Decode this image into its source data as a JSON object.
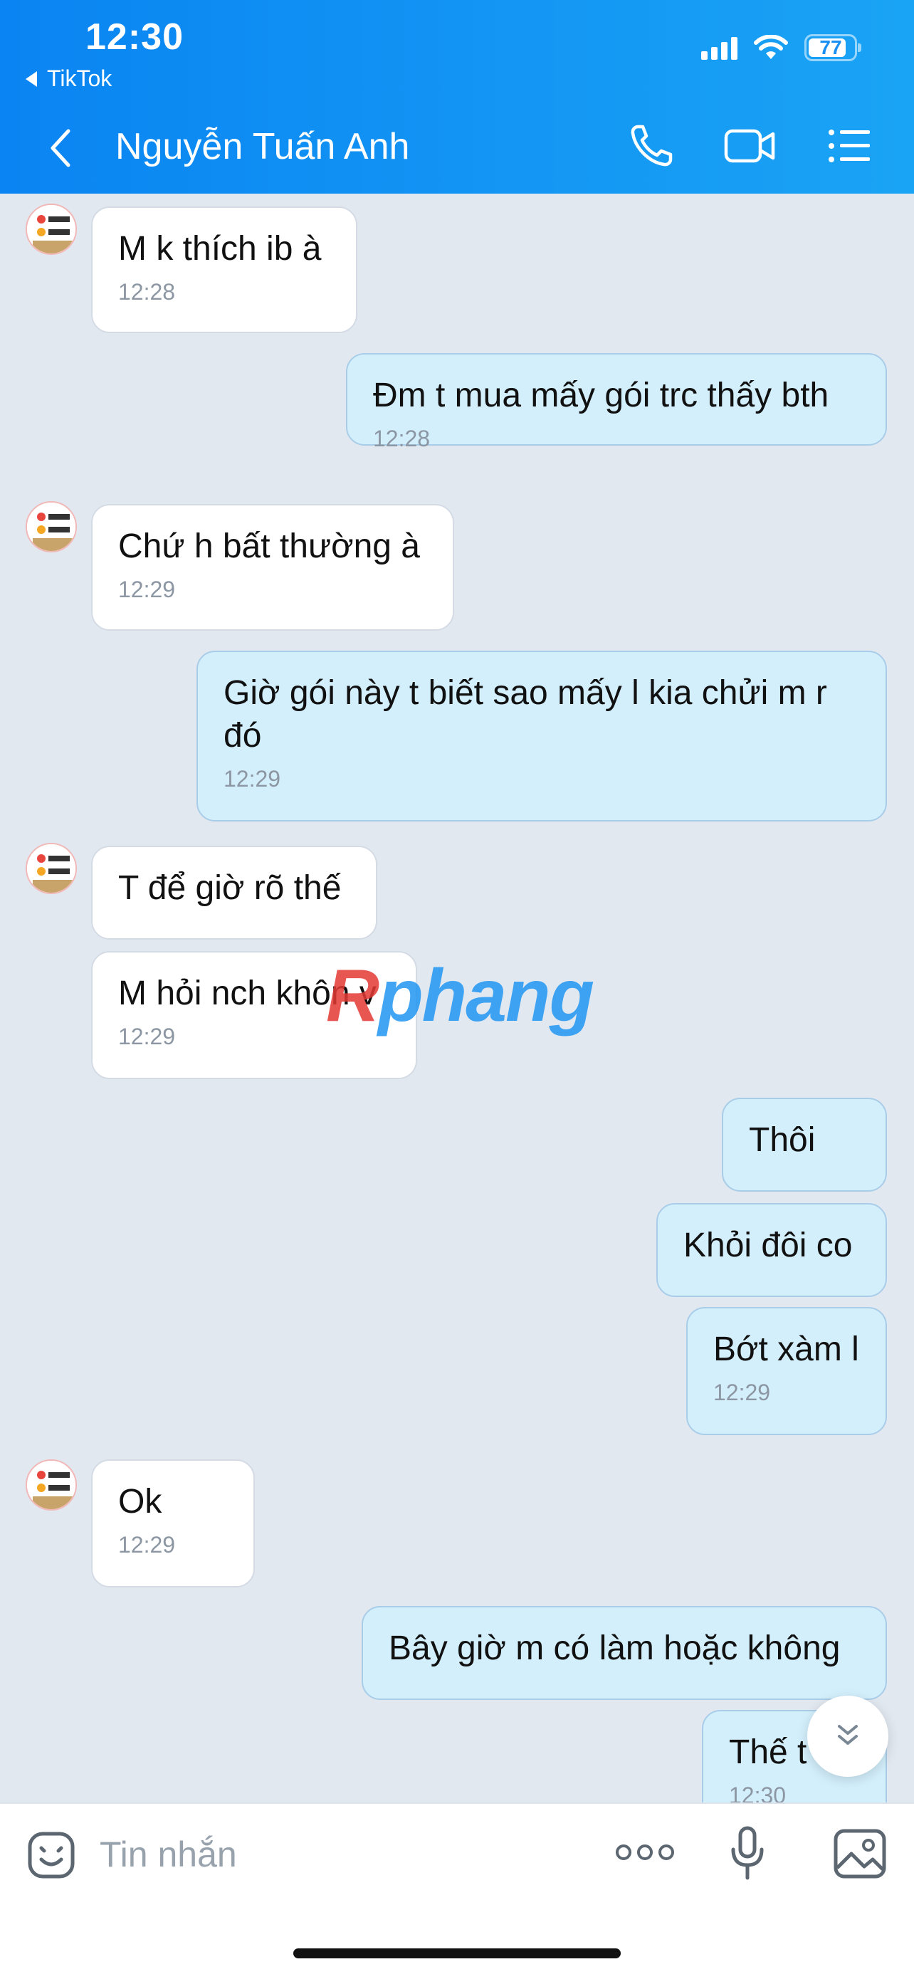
{
  "status_bar": {
    "time": "12:30",
    "back_app": "TikTok",
    "battery": "77"
  },
  "header": {
    "contact_name": "Nguyễn Tuấn Anh",
    "icons": [
      "back-chevron-icon",
      "phone-icon",
      "video-call-icon",
      "menu-list-icon"
    ]
  },
  "messages": [
    {
      "side": "in",
      "text": "M k thích ib à",
      "time": "12:28",
      "avatar": true
    },
    {
      "side": "out",
      "text": "Đm t mua mấy gói trc thấy bth",
      "time": "12:28"
    },
    {
      "side": "in",
      "text": "Chứ h bất thường à",
      "time": "12:29",
      "avatar": true
    },
    {
      "side": "out",
      "text": "Giờ gói này t biết sao mấy l kia chửi m r đó",
      "time": "12:29"
    },
    {
      "side": "in",
      "text": "T để giờ rõ thế",
      "time": "",
      "avatar": true
    },
    {
      "side": "in",
      "text": "M hỏi nch khôn v",
      "time": "12:29"
    },
    {
      "side": "out",
      "text": "Thôi",
      "time": ""
    },
    {
      "side": "out",
      "text": "Khỏi đôi co",
      "time": ""
    },
    {
      "side": "out",
      "text": "Bớt xàm l",
      "time": "12:29"
    },
    {
      "side": "in",
      "text": "Ok",
      "time": "12:29",
      "avatar": true
    },
    {
      "side": "out",
      "text": "Bây giờ m có làm hoặc không",
      "time": ""
    },
    {
      "side": "out",
      "text": "Thế t",
      "time": "12:30"
    }
  ],
  "watermark": {
    "r": "R",
    "rest": "phang"
  },
  "composer": {
    "placeholder": "Tin nhắn"
  },
  "colors": {
    "header": "#0a84f2",
    "incoming_bubble": "#ffffff",
    "outgoing_bubble": "#d3effc",
    "background": "#e2e8f0"
  }
}
